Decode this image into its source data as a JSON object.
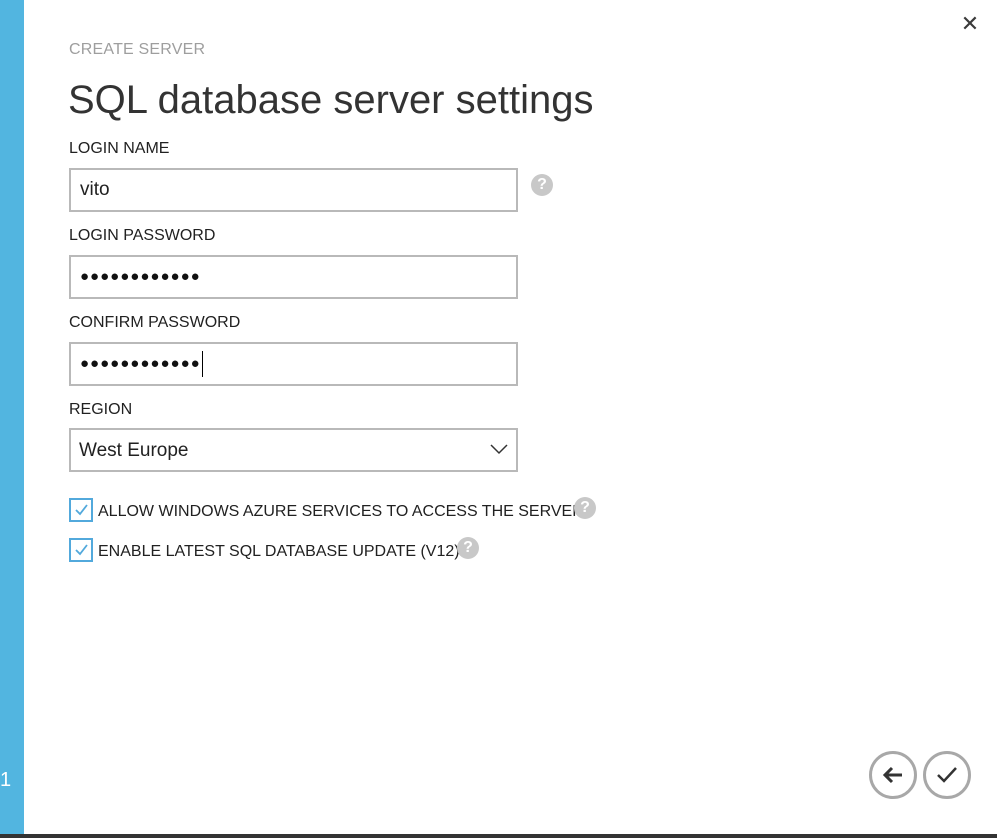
{
  "wizard": {
    "subtitle": "CREATE SERVER",
    "title": "SQL database server settings",
    "step_number": "1"
  },
  "form": {
    "login_name": {
      "label": "LOGIN NAME",
      "value": "vito"
    },
    "login_password": {
      "label": "LOGIN PASSWORD",
      "masked_value": "●●●●●●●●●●●●"
    },
    "confirm_password": {
      "label": "CONFIRM PASSWORD",
      "masked_value": "●●●●●●●●●●●●"
    },
    "region": {
      "label": "REGION",
      "selected": "West Europe"
    },
    "checkboxes": [
      {
        "label": "ALLOW WINDOWS AZURE SERVICES TO ACCESS THE SERVER.",
        "checked": true
      },
      {
        "label": "ENABLE LATEST SQL DATABASE UPDATE (V12)",
        "checked": true
      }
    ]
  },
  "icons": {
    "close": "close-icon",
    "help": "help-icon",
    "back": "arrow-left-icon",
    "confirm": "checkmark-icon",
    "dropdown": "chevron-down-icon"
  },
  "colors": {
    "accent_strip": "#52b5e0",
    "checkbox_border": "#52a9dc",
    "input_border": "#b9b9b9",
    "help_icon": "#c8c8c8"
  }
}
